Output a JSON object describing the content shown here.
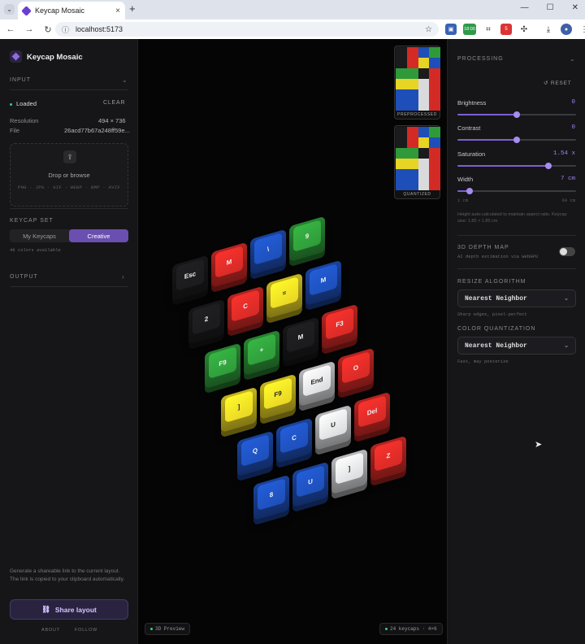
{
  "browser": {
    "tab_title": "Keycap Mosaic",
    "url": "localhost:5173",
    "ext_badge_time": "18:00",
    "ext_badge_count": "5"
  },
  "sidebar": {
    "brand": "Keycap Mosaic",
    "input_section": "INPUT",
    "status": "Loaded",
    "clear_label": "CLEAR",
    "resolution_label": "Resolution",
    "resolution_value": "494 × 736",
    "file_label": "File",
    "file_value": "26acd77b67a248ff59e...",
    "drop_text": "Drop or browse",
    "formats": "PNG · JPG · GIF · WEBP · BMP · AVIF",
    "keycap_section": "KEYCAP SET",
    "seg_my": "My Keycaps",
    "seg_creative": "Creative",
    "colors_available": "48 colors available",
    "output_section": "OUTPUT",
    "share_desc": "Generate a shareable link to the current layout. The link is copied to your clipboard automatically.",
    "share_label": "Share layout",
    "about": "ABOUT",
    "follow": "FOLLOW"
  },
  "viewport": {
    "preprocessed_label": "PREPROCESSED",
    "quantized_label": "QUANTIZED",
    "preview_label": "3D Preview",
    "keycap_count": "24 keycaps · 4×6"
  },
  "processing": {
    "title": "PROCESSING",
    "reset": "RESET",
    "brightness_label": "Brightness",
    "brightness_value": "0",
    "brightness_level": 0.5,
    "contrast_label": "Contrast",
    "contrast_value": "0",
    "contrast_level": 0.5,
    "saturation_label": "Saturation",
    "saturation_value": "1.54 x",
    "saturation_level": 0.77,
    "width_label": "Width",
    "width_value": "7 cm",
    "width_level": 0.1,
    "width_min": "1 cm",
    "width_max": "60 cm",
    "width_note": "Height auto-calculated to maintain aspect ratio. Keycap size: 1.85 × 1.85 cm",
    "depth_title": "3D DEPTH MAP",
    "depth_desc": "AI depth estimation via WebGPU",
    "depth_enabled": false,
    "resize_title": "RESIZE ALGORITHM",
    "resize_value": "Nearest Neighbor",
    "resize_desc": "Sharp edges, pixel-perfect",
    "quant_title": "COLOR QUANTIZATION",
    "quant_value": "Nearest Neighbor",
    "quant_desc": "Fast, may posterize"
  },
  "colors": {
    "black": "#1b1b1d",
    "red": "#d42a26",
    "blue": "#1e4fb8",
    "green": "#2f9a3a",
    "yellow": "#e8d424",
    "white": "#d9dadc",
    "accent": "#7d5fd0"
  },
  "mosaic": {
    "cols": 4,
    "rows": 6,
    "keys": [
      {
        "color": "black",
        "legend": "Esc"
      },
      {
        "color": "red",
        "legend": "M"
      },
      {
        "color": "blue",
        "legend": "\\"
      },
      {
        "color": "green",
        "legend": "9"
      },
      {
        "color": "black",
        "legend": "2"
      },
      {
        "color": "red",
        "legend": "C"
      },
      {
        "color": "yellow",
        "legend": "="
      },
      {
        "color": "blue",
        "legend": "M"
      },
      {
        "color": "green",
        "legend": "F9"
      },
      {
        "color": "green",
        "legend": "+"
      },
      {
        "color": "black",
        "legend": "M"
      },
      {
        "color": "red",
        "legend": "F3"
      },
      {
        "color": "yellow",
        "legend": "]"
      },
      {
        "color": "yellow",
        "legend": "F9"
      },
      {
        "color": "white",
        "legend": "End"
      },
      {
        "color": "red",
        "legend": "O"
      },
      {
        "color": "blue",
        "legend": "Q"
      },
      {
        "color": "blue",
        "legend": "C"
      },
      {
        "color": "white",
        "legend": "U"
      },
      {
        "color": "red",
        "legend": "Del"
      },
      {
        "color": "blue",
        "legend": "8"
      },
      {
        "color": "blue",
        "legend": "U"
      },
      {
        "color": "white",
        "legend": "]"
      },
      {
        "color": "red",
        "legend": "Z"
      }
    ],
    "preprocessed": [
      "black",
      "red",
      "blue",
      "green",
      "black",
      "red",
      "yellow",
      "blue",
      "green",
      "green",
      "black",
      "red",
      "yellow",
      "yellow",
      "white",
      "red",
      "blue",
      "blue",
      "white",
      "red",
      "blue",
      "blue",
      "white",
      "red"
    ],
    "quantized": [
      "black",
      "red",
      "blue",
      "green",
      "black",
      "red",
      "yellow",
      "blue",
      "green",
      "green",
      "black",
      "red",
      "yellow",
      "yellow",
      "white",
      "red",
      "blue",
      "blue",
      "white",
      "red",
      "blue",
      "blue",
      "white",
      "red"
    ]
  }
}
